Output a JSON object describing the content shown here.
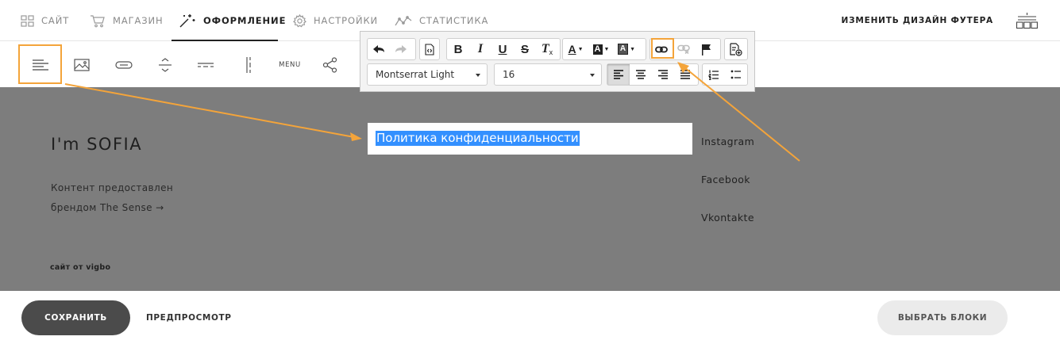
{
  "nav": {
    "items": [
      {
        "label": "САЙТ",
        "icon": "grid-icon"
      },
      {
        "label": "МАГАЗИН",
        "icon": "cart-icon"
      },
      {
        "label": "ОФОРМЛЕНИЕ",
        "icon": "magic-wand-icon",
        "active": true
      },
      {
        "label": "НАСТРОЙКИ",
        "icon": "gear-icon"
      },
      {
        "label": "СТАТИСТИКА",
        "icon": "chart-line-icon"
      }
    ],
    "footer_design_label": "ИЗМЕНИТЬ ДИЗАЙН ФУТЕРА"
  },
  "widgets": {
    "menu_label": "MENU"
  },
  "footer": {
    "brand": "I'm SOFIA",
    "desc_line1": "Контент предоставлен",
    "desc_line2": "брендом The Sense →",
    "credit": "сайт от vigbo",
    "editing_text": "Политика конфиденциальности",
    "social": [
      "Instagram",
      "Facebook",
      "Vkontakte"
    ]
  },
  "toolbar": {
    "font_family": "Montserrat Light",
    "font_size": "16",
    "bold": "B",
    "italic": "I",
    "underline": "U",
    "strike": "S",
    "clear_format": "T",
    "text_color": "A",
    "bg_color": "A",
    "text_bg": "A"
  },
  "bottom": {
    "save_label": "СОХРАНИТЬ",
    "preview_label": "ПРЕДПРОСМОТР",
    "choose_blocks_label": "ВЫБРАТЬ БЛОКИ"
  },
  "colors": {
    "accent_orange": "#f4a43a",
    "footer_bg": "#7d7d7d",
    "selection_blue": "#3390ff",
    "save_bg": "#4b4b4b"
  }
}
